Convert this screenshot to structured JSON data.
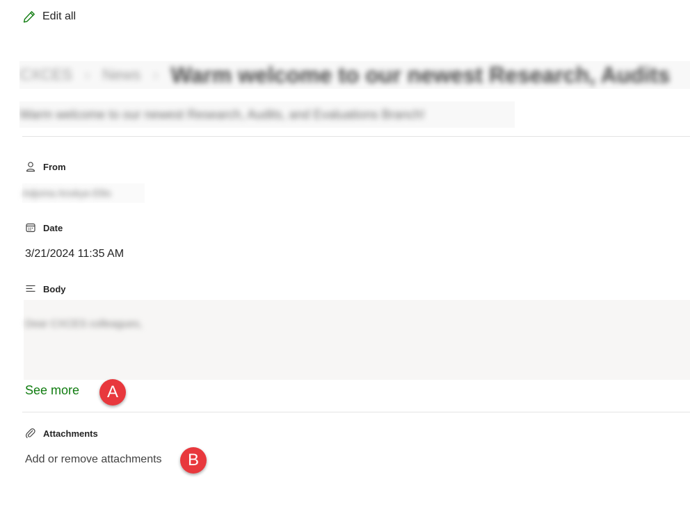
{
  "toolbar": {
    "edit_all_label": "Edit all",
    "edit_icon": "pencil-icon"
  },
  "header": {
    "breadcrumb_1": "CXCES",
    "breadcrumb_2": "News",
    "breadcrumb_sep": "›",
    "title": "Warm welcome to our newest Research, Audits",
    "subtitle": "Warm welcome to our newest Research, Audits, and Evaluations Branch!"
  },
  "fields": {
    "from": {
      "label": "From",
      "icon": "person-icon",
      "value": "Adjoma Anokye-Ellis"
    },
    "date": {
      "label": "Date",
      "icon": "calendar-icon",
      "value": "3/21/2024 11:35 AM"
    },
    "body": {
      "label": "Body",
      "icon": "text-lines-icon",
      "value": "Dear CXCES colleagues,",
      "see_more": "See more"
    },
    "attachments": {
      "label": "Attachments",
      "icon": "paperclip-icon",
      "action": "Add or remove attachments"
    }
  },
  "annotations": {
    "marker_a": "A",
    "marker_b": "B"
  },
  "colors": {
    "link_green": "#107c10",
    "marker_red": "#e8383d",
    "body_bg": "#f7f6f5"
  }
}
